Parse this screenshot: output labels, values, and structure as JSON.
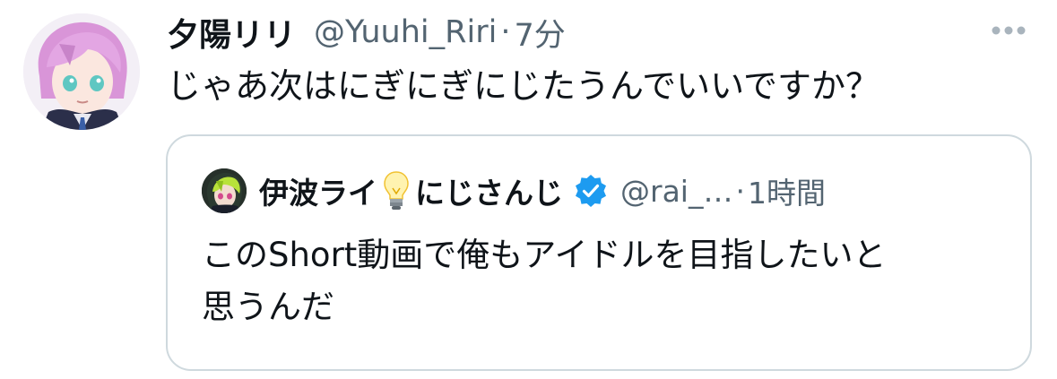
{
  "tweet": {
    "display_name": "夕陽リリ",
    "handle": "@Yuuhi_Riri",
    "separator": "·",
    "time": "7分",
    "text": "じゃあ次はにぎにぎにじたうんでいいですか？",
    "more_icon": "more-horizontal-icon",
    "avatar_icon": "avatar-pink-hair-icon"
  },
  "quoted": {
    "display_name": "伊波ライ",
    "bulb_icon": "lightbulb-icon",
    "display_name_suffix": "にじさんじ",
    "verified_icon": "verified-badge-icon",
    "handle": "@rai_…",
    "separator": "·",
    "time": "1時間",
    "text_lines": [
      "このShort動画で俺もアイドルを目指したいと",
      "思うんだ"
    ]
  },
  "colors": {
    "text_primary": "#0f1419",
    "text_secondary": "#536471",
    "border": "#cfd9de",
    "verified": "#1d9bf0"
  }
}
